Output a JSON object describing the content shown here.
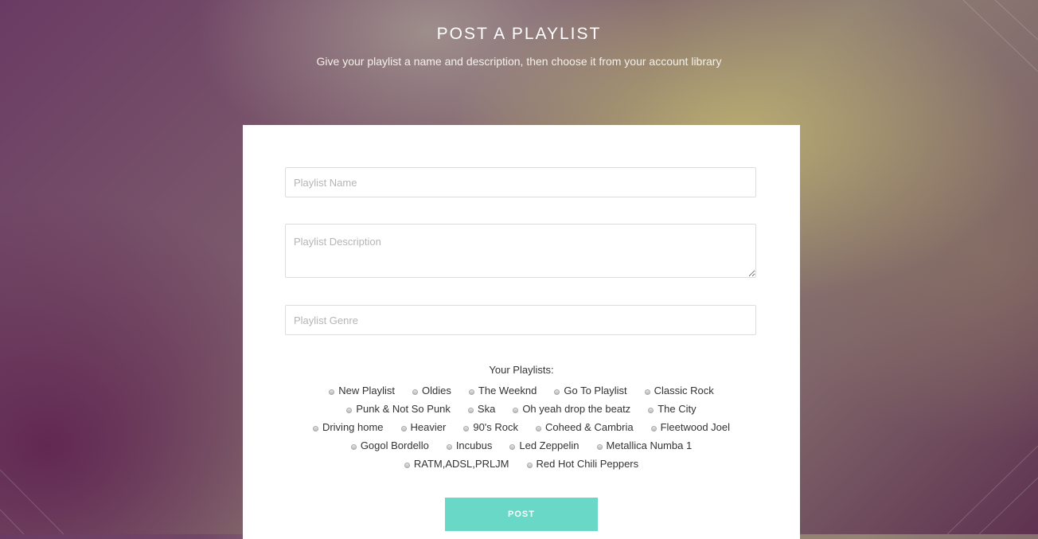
{
  "header": {
    "title": "POST A PLAYLIST",
    "subtitle": "Give your playlist a name and description, then choose it from your account library"
  },
  "form": {
    "name_placeholder": "Playlist Name",
    "description_placeholder": "Playlist Description",
    "genre_placeholder": "Playlist Genre",
    "playlists_label": "Your Playlists:",
    "playlist_rows": [
      [
        "New Playlist",
        "Oldies",
        "The Weeknd",
        "Go To Playlist",
        "Classic Rock"
      ],
      [
        "Punk & Not So Punk",
        "Ska",
        "Oh yeah drop the beatz",
        "The City"
      ],
      [
        "Driving home",
        "Heavier",
        "90's Rock",
        "Coheed & Cambria",
        "Fleetwood Joel"
      ],
      [
        "Gogol Bordello",
        "Incubus",
        "Led Zeppelin",
        "Metallica Numba 1"
      ],
      [
        "RATM,ADSL,PRLJM",
        "Red Hot Chili Peppers"
      ]
    ],
    "post_label": "POST"
  },
  "colors": {
    "accent": "#6ad8c7",
    "card": "#ffffff"
  }
}
